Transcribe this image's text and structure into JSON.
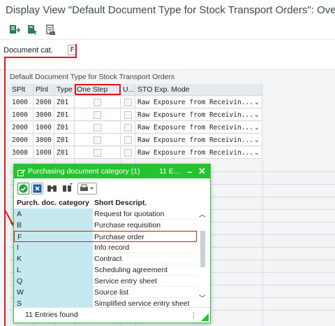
{
  "window": {
    "title": "Display View \"Default Document Type for Stock Transport Orders\": Overv"
  },
  "toolbar": {
    "icons": [
      "export-icon",
      "select-layout-icon",
      "print-icon"
    ]
  },
  "header": {
    "doc_cat_label": "Document cat.",
    "doc_cat_value": "F"
  },
  "table": {
    "title": "Default Document Type for Stock Transport Orders",
    "columns": [
      "SPlt",
      "Plnt",
      "Type",
      "One Step",
      "U...",
      "STO Exp. Mode"
    ],
    "rows": [
      {
        "splt": "1000",
        "plnt": "2000",
        "type": "Z01",
        "mode": "Raw Exposure from Receivin..."
      },
      {
        "splt": "1000",
        "plnt": "3000",
        "type": "Z01",
        "mode": "Raw Exposure from Receivin..."
      },
      {
        "splt": "2000",
        "plnt": "1000",
        "type": "Z01",
        "mode": "Raw Exposure from Receivin..."
      },
      {
        "splt": "2000",
        "plnt": "3000",
        "type": "Z01",
        "mode": "Raw Exposure from Receivin..."
      },
      {
        "splt": "3000",
        "plnt": "1000",
        "type": "Z01",
        "mode": "Raw Exposure from Receivin..."
      }
    ]
  },
  "popup": {
    "title": "Purchasing document category (1)",
    "title_suffix": "11 E...",
    "col_key": "Purch. doc. category",
    "col_desc": "Short Descript.",
    "items": [
      {
        "key": "A",
        "desc": "Request for quotation"
      },
      {
        "key": "B",
        "desc": "Purchase requisition"
      },
      {
        "key": "F",
        "desc": "Purchase order"
      },
      {
        "key": "I",
        "desc": "Info record"
      },
      {
        "key": "K",
        "desc": "Contract"
      },
      {
        "key": "L",
        "desc": "Scheduling agreement"
      },
      {
        "key": "Q",
        "desc": "Service entry sheet"
      },
      {
        "key": "W",
        "desc": "Source list"
      },
      {
        "key": "S",
        "desc": "Simplified service entry sheet"
      }
    ],
    "status": "11 Entries found",
    "accent": "#22c52e",
    "highlight": "#e01818"
  }
}
